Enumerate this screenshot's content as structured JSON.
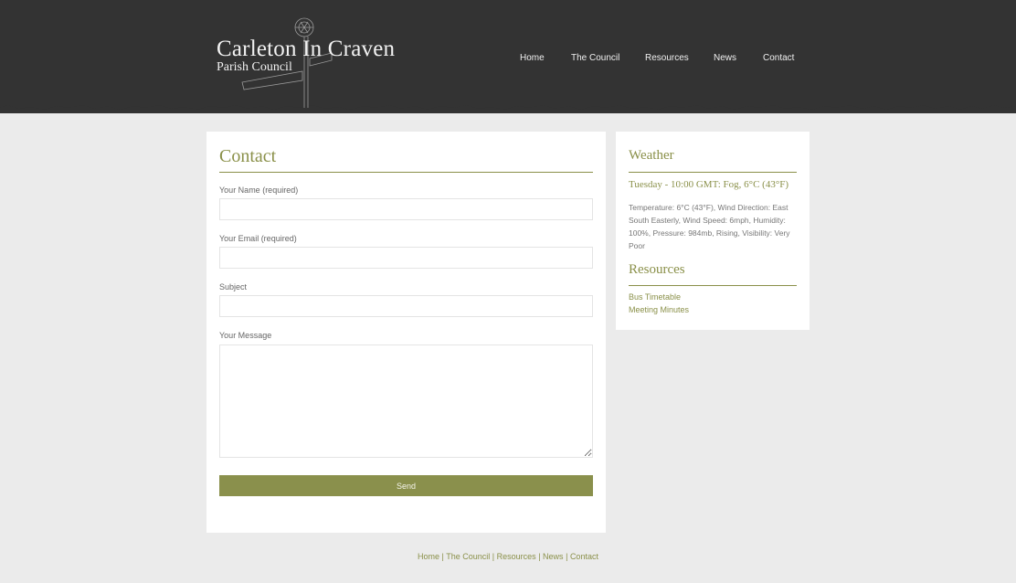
{
  "site": {
    "title": "Carleton In Craven",
    "subtitle": "Parish Council"
  },
  "nav": {
    "items": [
      "Home",
      "The Council",
      "Resources",
      "News",
      "Contact"
    ]
  },
  "contact": {
    "heading": "Contact",
    "name_label": "Your Name (required)",
    "name_value": "",
    "email_label": "Your Email (required)",
    "email_value": "",
    "subject_label": "Subject",
    "subject_value": "",
    "message_label": "Your Message",
    "message_value": "",
    "send_label": "Send"
  },
  "weather": {
    "heading": "Weather",
    "summary": "Tuesday - 10:00 GMT: Fog, 6°C (43°F)",
    "details": "Temperature: 6°C (43°F), Wind Direction: East South Easterly, Wind Speed: 6mph, Humidity: 100%, Pressure: 984mb, Rising, Visibility: Very Poor"
  },
  "resources": {
    "heading": "Resources",
    "links": [
      "Bus Timetable",
      "Meeting Minutes"
    ]
  },
  "footer": {
    "links": [
      "Home",
      "The Council",
      "Resources",
      "News",
      "Contact"
    ],
    "separator": "|"
  },
  "colors": {
    "header_bg": "#333333",
    "page_bg": "#ebebeb",
    "accent": "#8a9049",
    "button": "#8a904c"
  }
}
